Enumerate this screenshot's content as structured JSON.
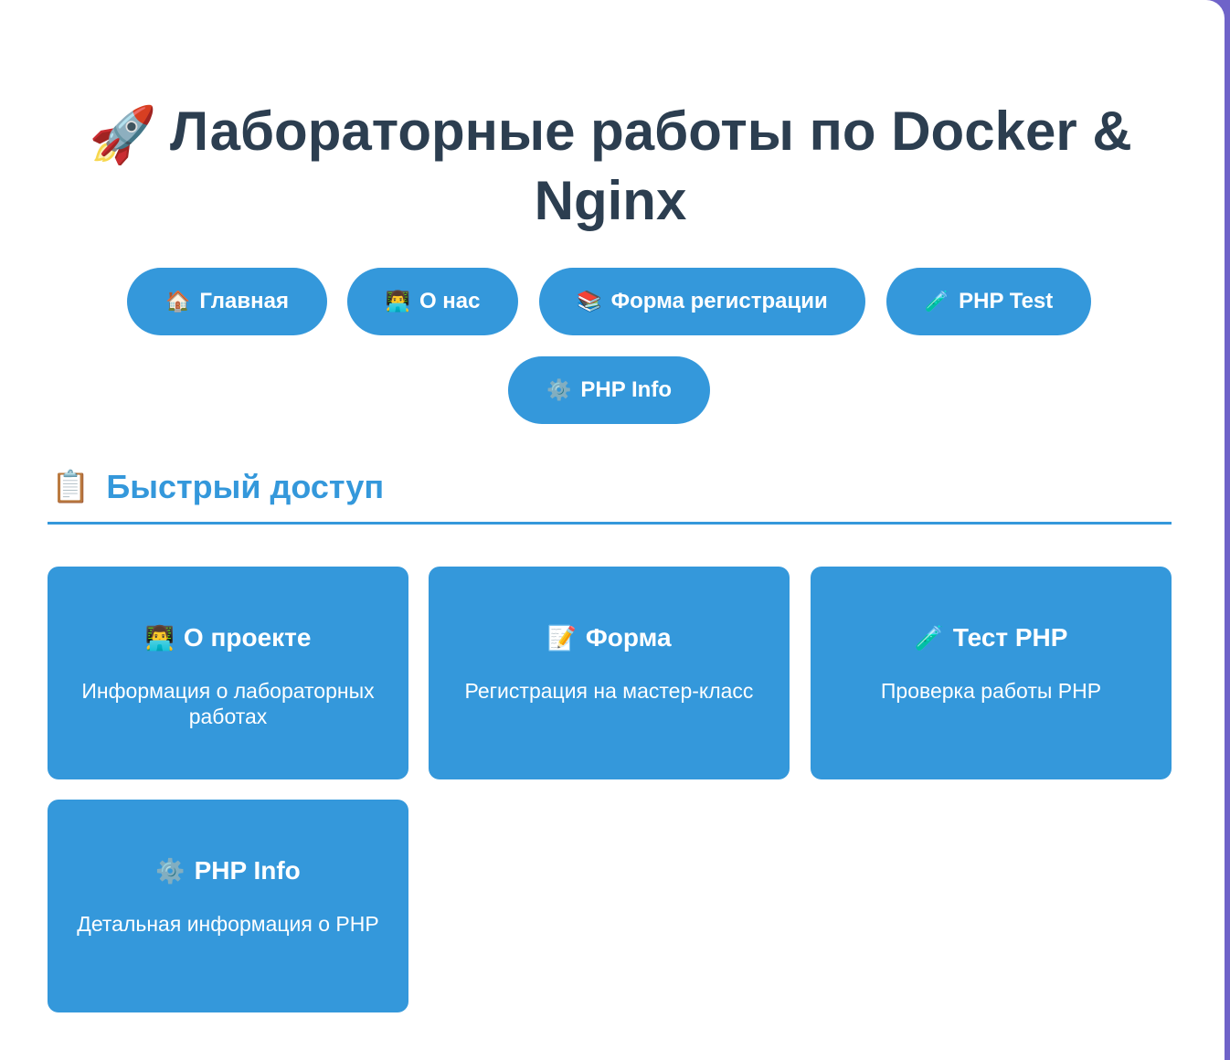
{
  "header": {
    "title_icon": "🚀",
    "title": "Лабораторные работы по Docker & Nginx"
  },
  "nav": [
    {
      "icon": "🏠",
      "label": "Главная"
    },
    {
      "icon": "👨‍💻",
      "label": "О нас"
    },
    {
      "icon": "📚",
      "label": "Форма регистрации"
    },
    {
      "icon": "🧪",
      "label": "PHP Test"
    },
    {
      "icon": "⚙️",
      "label": "PHP Info"
    }
  ],
  "quick_access": {
    "icon": "📋",
    "title": "Быстрый доступ",
    "cards": [
      {
        "icon": "👨‍💻",
        "title": "О проекте",
        "description": "Информация о лабораторных работах"
      },
      {
        "icon": "📝",
        "title": "Форма",
        "description": "Регистрация на мастер-класс"
      },
      {
        "icon": "🧪",
        "title": "Тест PHP",
        "description": "Проверка работы PHP"
      },
      {
        "icon": "⚙️",
        "title": "PHP Info",
        "description": "Детальная информация о PHP"
      }
    ]
  },
  "colors": {
    "accent": "#3498db",
    "heading": "#2c3e50",
    "background_gradient": "#6f63c9"
  }
}
